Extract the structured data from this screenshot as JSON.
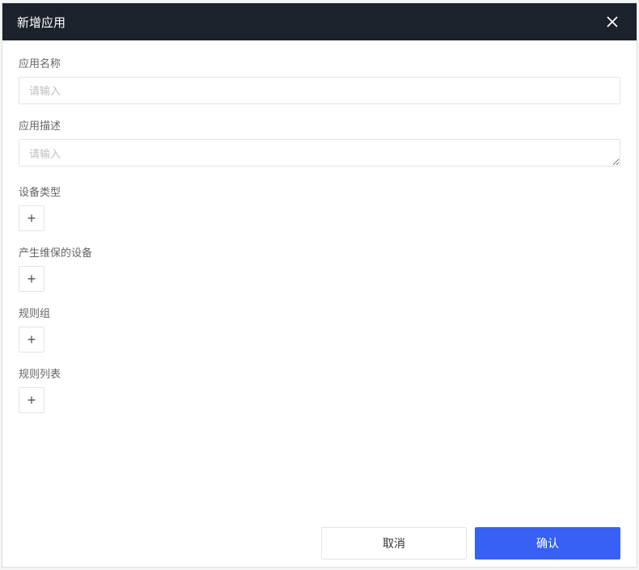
{
  "header": {
    "title": "新增应用"
  },
  "form": {
    "appName": {
      "label": "应用名称",
      "placeholder": "请输入",
      "value": ""
    },
    "appDescription": {
      "label": "应用描述",
      "placeholder": "请输入",
      "value": ""
    },
    "deviceType": {
      "label": "设备类型"
    },
    "maintenanceDevice": {
      "label": "产生维保的设备"
    },
    "ruleGroup": {
      "label": "规则组"
    },
    "ruleList": {
      "label": "规则列表"
    }
  },
  "footer": {
    "cancel": "取消",
    "confirm": "确认"
  }
}
